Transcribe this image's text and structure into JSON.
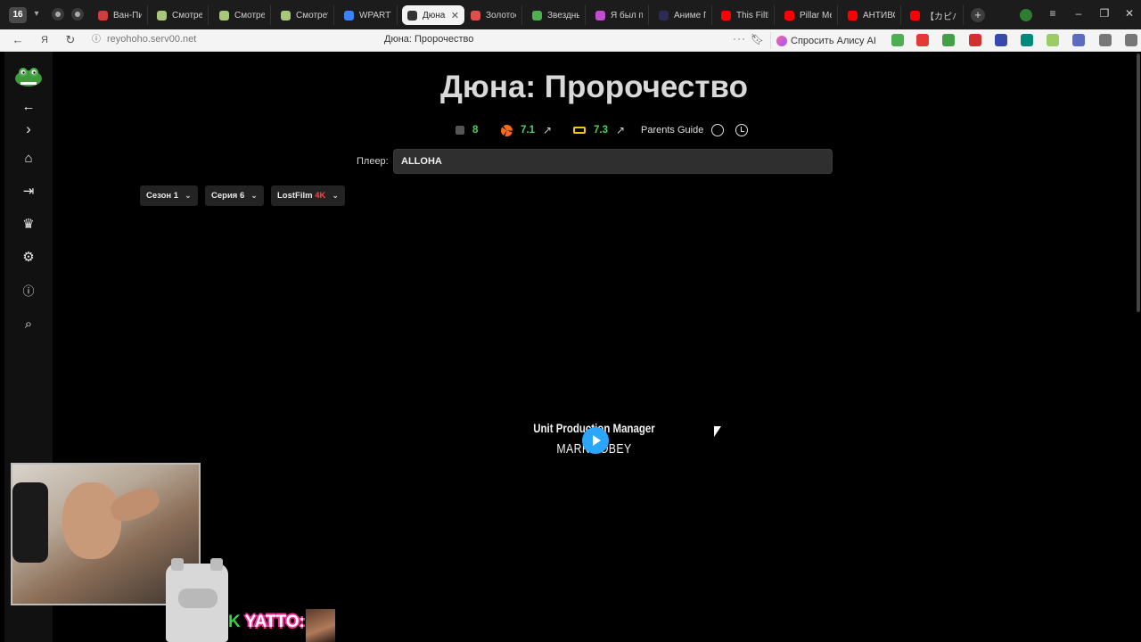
{
  "browser": {
    "tab_count": "16",
    "tabs": [
      {
        "label": "Ван-Пис (",
        "color": "#d23c3c"
      },
      {
        "label": "Смотреть",
        "color": "#a7c77a"
      },
      {
        "label": "Смотреть",
        "color": "#a7c77a"
      },
      {
        "label": "Смотреть",
        "color": "#a7c77a"
      },
      {
        "label": "WPARTY",
        "color": "#3b82f6"
      },
      {
        "label": "Дюна: П",
        "color": "#333333"
      },
      {
        "label": "Золотое б",
        "color": "#e04e4e"
      },
      {
        "label": "Звездные",
        "color": "#4caf50"
      },
      {
        "label": "Я был пре",
        "color": "#c04ecf"
      },
      {
        "label": "Аниме По",
        "color": "#2b2b55"
      },
      {
        "label": "This Filthy",
        "color": "#ff0000"
      },
      {
        "label": "Pillar Men",
        "color": "#ff0000"
      },
      {
        "label": "АНТИВСЕ",
        "color": "#ff0000"
      },
      {
        "label": "【カピバラ】",
        "color": "#ff0000"
      }
    ],
    "url": "reyohoho.serv00.net",
    "page_title": "Дюна: Пророчество",
    "alice_label": "Спросить Алису AI",
    "extension_colors": [
      "#4caf50",
      "#e53935",
      "#43a047",
      "#d32f2f",
      "#3949ab",
      "#00897b",
      "#9ccc65",
      "#5c6bc0",
      "#777777",
      "#777777"
    ]
  },
  "sidebar": {
    "icons": [
      "back-arrow-icon",
      "forward-arrow-icon",
      "home-icon",
      "login-icon",
      "trophy-icon",
      "gear-icon",
      "info-icon",
      "search-icon"
    ]
  },
  "movie": {
    "title": "Дюна: Пророчество",
    "ratings": {
      "site": "8",
      "kinopoisk": "7.1",
      "imdb": "7.3",
      "parents_guide": "Parents Guide"
    },
    "player": {
      "label": "Плеер:",
      "value": "ALLOHA"
    },
    "season": "Сезон 1",
    "episode": "Серия 6",
    "voiceover": "LostFilm",
    "quality": "4K"
  },
  "video": {
    "credit_role": "Unit Production Manager",
    "credit_name": "MARK TOBEY"
  },
  "overlay": {
    "chat_name": "YATTO:",
    "chat_prefix": "K"
  }
}
